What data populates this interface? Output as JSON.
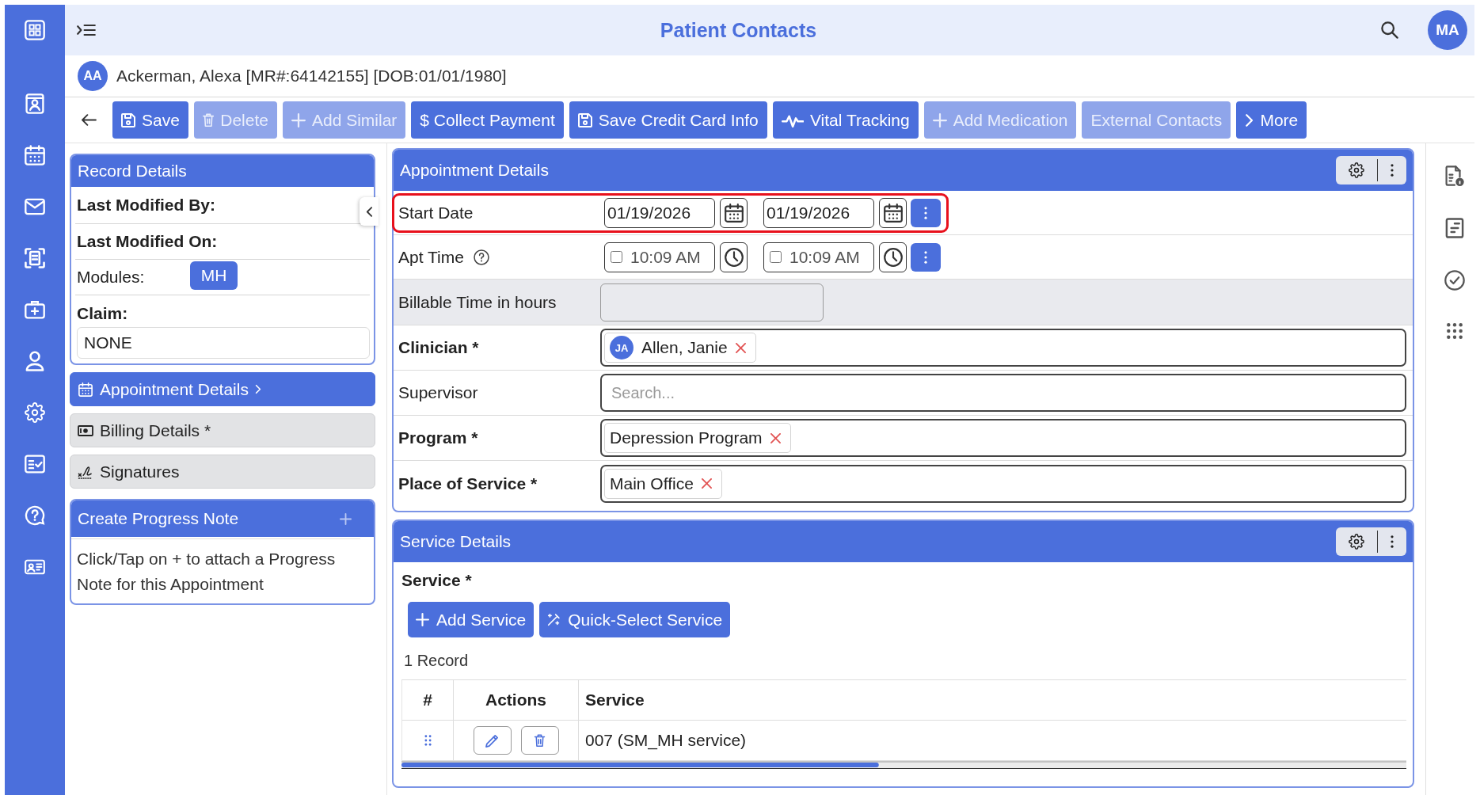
{
  "header": {
    "title": "Patient Contacts",
    "user_initials": "MA"
  },
  "patient": {
    "initials": "AA",
    "summary": "Ackerman, Alexa [MR#:64142155] [DOB:01/01/1980]"
  },
  "toolbar": {
    "buttons": [
      {
        "label": "Save",
        "kind": "save",
        "disabled": false
      },
      {
        "label": "Delete",
        "kind": "delete",
        "disabled": true
      },
      {
        "label": "Add Similar",
        "kind": "add",
        "disabled": true
      },
      {
        "label": "$ Collect Payment",
        "kind": "payment",
        "disabled": false
      },
      {
        "label": "Save Credit Card Info",
        "kind": "save",
        "disabled": false
      },
      {
        "label": "Vital Tracking",
        "kind": "vitals",
        "disabled": false
      },
      {
        "label": "Add Medication",
        "kind": "add",
        "disabled": true
      },
      {
        "label": "External Contacts",
        "kind": "link",
        "disabled": true
      },
      {
        "label": "More",
        "kind": "more",
        "disabled": false
      }
    ]
  },
  "record_details": {
    "title": "Record Details",
    "fields": [
      {
        "kind": "label",
        "label": "Last Modified By:"
      },
      {
        "kind": "label",
        "label": "Last Modified On:"
      },
      {
        "kind": "badge",
        "label": "Modules:",
        "badge": "MH"
      },
      {
        "kind": "field",
        "label": "Claim:",
        "value": "NONE"
      }
    ]
  },
  "section_nav": [
    {
      "kind": "appointment",
      "label": "Appointment Details",
      "selected": true
    },
    {
      "kind": "billing",
      "label": "Billing Details *",
      "selected": false
    },
    {
      "kind": "signatures",
      "label": "Signatures",
      "selected": false
    }
  ],
  "progress_note": {
    "title": "Create Progress Note",
    "hint": "Click/Tap on + to attach a Progress Note for this Appointment"
  },
  "appointment_details": {
    "title": "Appointment Details",
    "rows": [
      {
        "kind": "date_range",
        "label": "Start Date",
        "required": false,
        "help": false,
        "highlighted": true,
        "disabled": false,
        "dates": [
          "01/19/2026",
          "01/19/2026"
        ]
      },
      {
        "kind": "time_range",
        "label": "Apt Time",
        "required": false,
        "help": true,
        "highlighted": false,
        "disabled": false,
        "times": [
          {
            "value": "10:09 AM",
            "checked": false
          },
          {
            "value": "10:09 AM",
            "checked": false
          }
        ]
      },
      {
        "kind": "number",
        "label": "Billable Time in hours",
        "required": false,
        "help": false,
        "highlighted": false,
        "disabled": true
      },
      {
        "kind": "chips",
        "label": "Clinician *",
        "required": true,
        "help": false,
        "highlighted": false,
        "disabled": false,
        "chips": [
          {
            "text": "Allen, Janie",
            "initials": "JA"
          }
        ]
      },
      {
        "kind": "search",
        "label": "Supervisor",
        "required": false,
        "help": false,
        "highlighted": false,
        "disabled": false,
        "placeholder": "Search..."
      },
      {
        "kind": "chips",
        "label": "Program *",
        "required": true,
        "help": false,
        "highlighted": false,
        "disabled": false,
        "chips": [
          {
            "text": "Depression Program"
          }
        ]
      },
      {
        "kind": "chips",
        "label": "Place of Service *",
        "required": true,
        "help": false,
        "highlighted": false,
        "disabled": false,
        "chips": [
          {
            "text": "Main Office"
          }
        ]
      }
    ]
  },
  "service_details": {
    "title": "Service Details",
    "field_label": "Service *",
    "buttons": [
      {
        "label": "Add Service",
        "kind": "add"
      },
      {
        "label": "Quick-Select Service",
        "kind": "quick"
      }
    ],
    "record_count": "1 Record",
    "table": {
      "columns": [
        "#",
        "Actions",
        "Service"
      ],
      "rows": [
        {
          "service": "007 (SM_MH service)"
        }
      ]
    }
  }
}
